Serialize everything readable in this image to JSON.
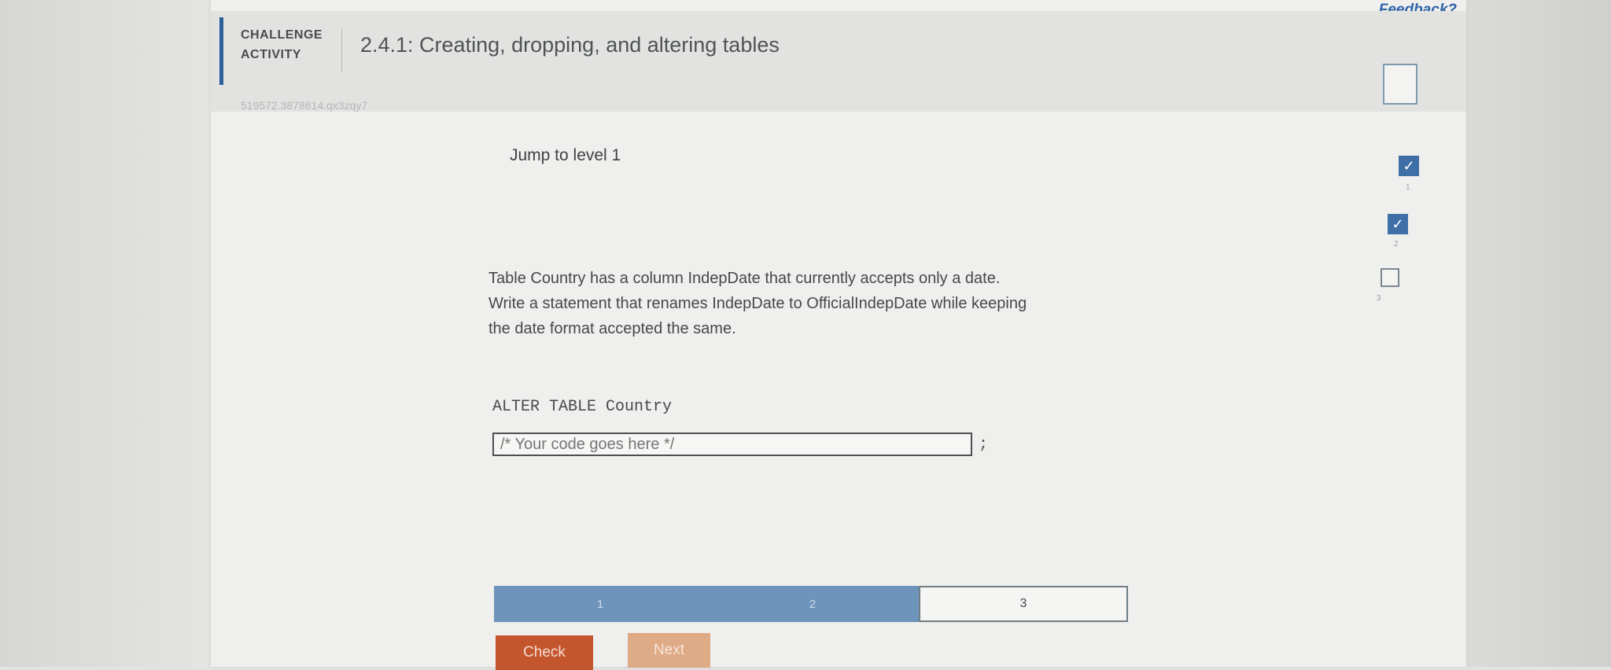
{
  "header": {
    "feedback_label": "Feedback?",
    "activity_type_line1": "CHALLENGE",
    "activity_type_line2": "ACTIVITY",
    "activity_title": "2.4.1: Creating, dropping, and altering tables",
    "activity_id": "519572.3878614.qx3zqy7"
  },
  "main": {
    "jump_label": "Jump to level 1",
    "prompt_lines": [
      "Table Country has a column IndepDate that currently accepts only a date.",
      "Write a statement that renames IndepDate to OfficialIndepDate while keeping",
      "the date format accepted the same."
    ],
    "code_prefix": "ALTER TABLE Country",
    "code_placeholder": "/* Your code goes here */",
    "code_suffix": ";"
  },
  "levels": {
    "items": [
      {
        "label": "1",
        "status": "completed"
      },
      {
        "label": "2",
        "status": "completed"
      },
      {
        "label": "3",
        "status": "current"
      }
    ]
  },
  "buttons": {
    "check_label": "Check",
    "next_label": "Next"
  },
  "progress_rail": {
    "items": [
      {
        "label": "1",
        "completed": true
      },
      {
        "label": "2",
        "completed": true
      },
      {
        "label": "3",
        "completed": false
      }
    ]
  },
  "colors": {
    "accent": "#2b5f98",
    "level_completed": "#6f94bb",
    "check_button": "#c4562d",
    "next_button": "#dfaa86"
  }
}
